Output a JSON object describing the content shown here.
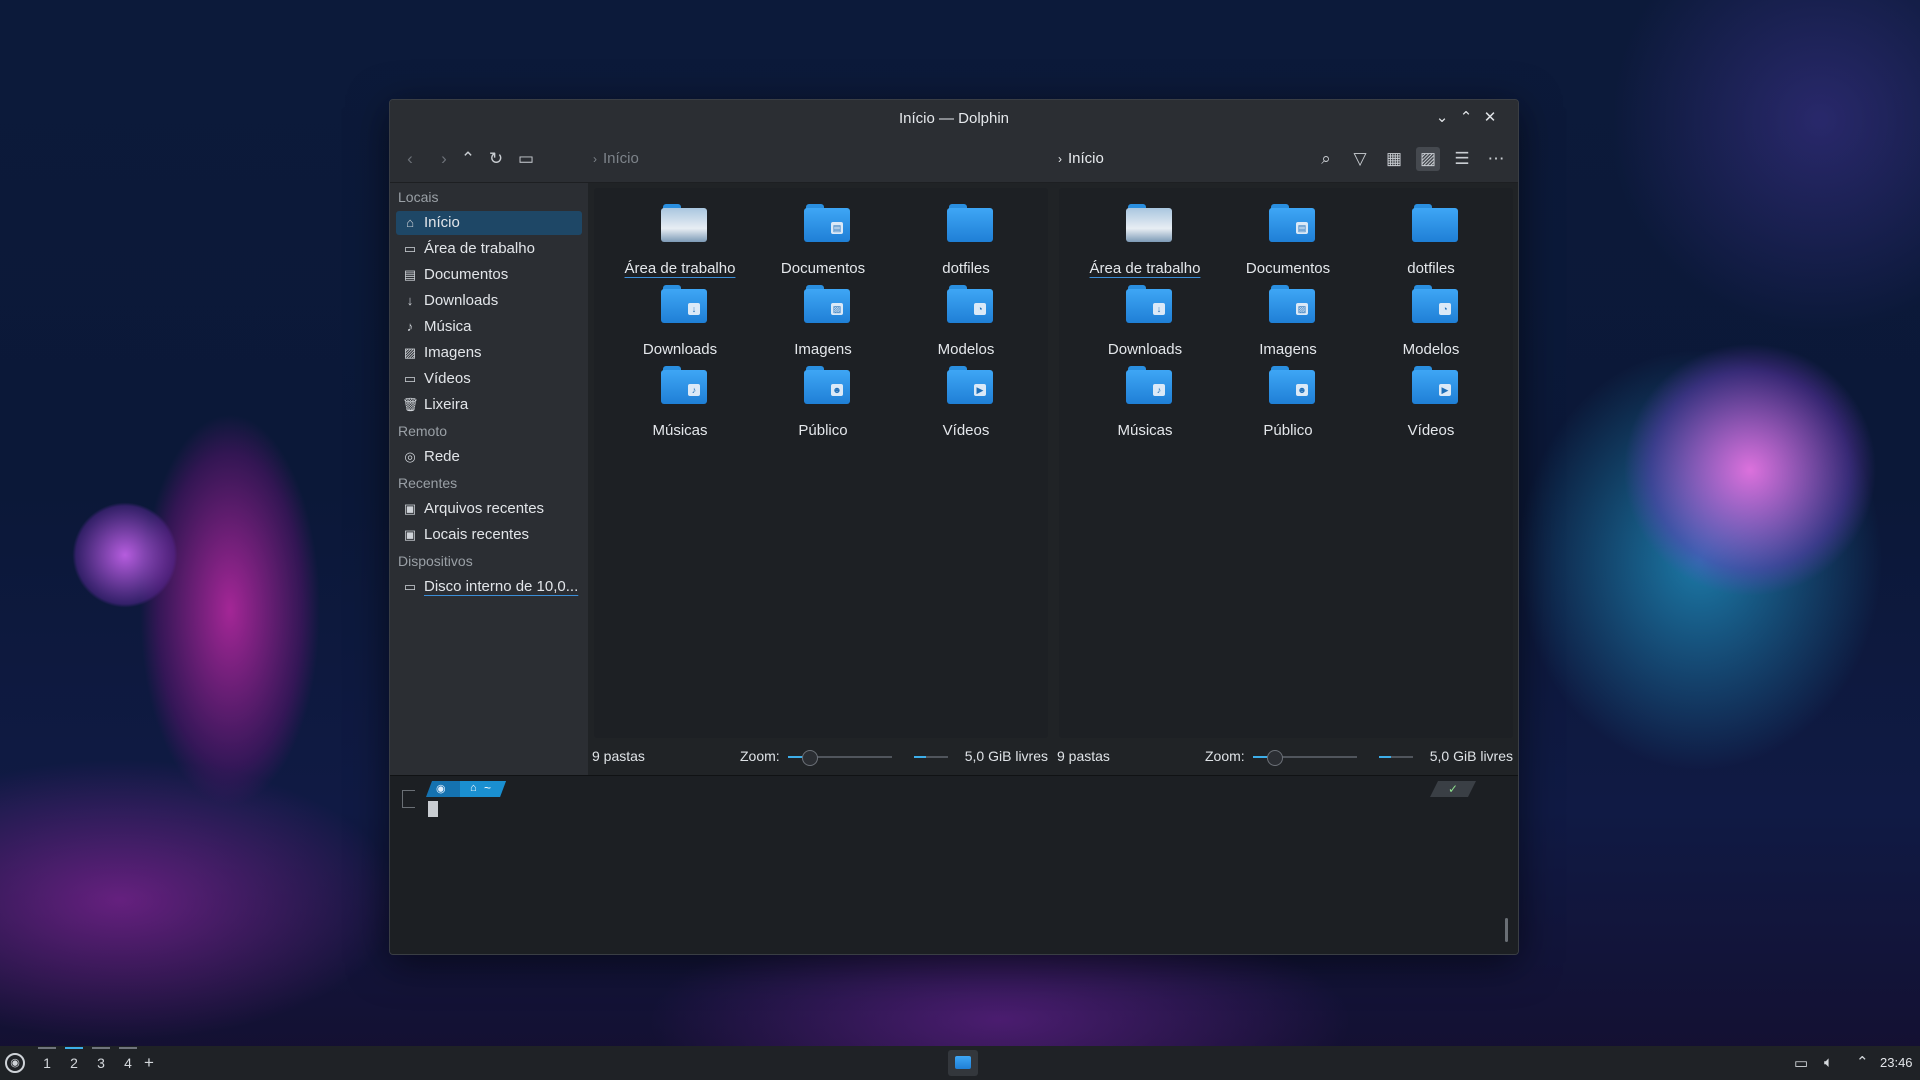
{
  "window": {
    "title": "Início — Dolphin",
    "controls": {
      "minimize": "⌄",
      "maximize": "⌃",
      "close": "✕"
    }
  },
  "toolbar": {
    "left_breadcrumb": "Início",
    "right_breadcrumb": "Início",
    "icons": [
      "back-icon",
      "forward-icon",
      "up-icon",
      "reload-icon",
      "new-tab-icon",
      "search-icon",
      "filter-icon",
      "icons-view-icon",
      "preview-icon",
      "split-view-icon",
      "menu-icon"
    ]
  },
  "sidebar": {
    "sections": [
      {
        "title": "Locais",
        "items": [
          {
            "label": "Início",
            "icon": "home-icon",
            "glyph": "⌂",
            "selected": true
          },
          {
            "label": "Área de trabalho",
            "icon": "desktop-icon",
            "glyph": "▭"
          },
          {
            "label": "Documentos",
            "icon": "documents-icon",
            "glyph": "▤"
          },
          {
            "label": "Downloads",
            "icon": "downloads-icon",
            "glyph": "↓"
          },
          {
            "label": "Música",
            "icon": "music-icon",
            "glyph": "♪"
          },
          {
            "label": "Imagens",
            "icon": "pictures-icon",
            "glyph": "▨"
          },
          {
            "label": "Vídeos",
            "icon": "videos-icon",
            "glyph": "▭"
          },
          {
            "label": "Lixeira",
            "icon": "trash-icon",
            "glyph": "🗑"
          }
        ]
      },
      {
        "title": "Remoto",
        "items": [
          {
            "label": "Rede",
            "icon": "network-icon",
            "glyph": "◎"
          }
        ]
      },
      {
        "title": "Recentes",
        "items": [
          {
            "label": "Arquivos recentes",
            "icon": "recent-files-icon",
            "glyph": "▣"
          },
          {
            "label": "Locais recentes",
            "icon": "recent-locations-icon",
            "glyph": "▣"
          }
        ]
      },
      {
        "title": "Dispositivos",
        "items": [
          {
            "label": "Disco interno de 10,0...",
            "icon": "drive-icon",
            "glyph": "▭"
          }
        ]
      }
    ]
  },
  "folders": [
    {
      "label": "Área de trabalho",
      "kind": "desktop",
      "emblem": ""
    },
    {
      "label": "Documentos",
      "kind": "folder",
      "emblem": "▤"
    },
    {
      "label": "dotfiles",
      "kind": "folder",
      "emblem": ""
    },
    {
      "label": "Downloads",
      "kind": "folder",
      "emblem": "↓"
    },
    {
      "label": "Imagens",
      "kind": "folder",
      "emblem": "▨"
    },
    {
      "label": "Modelos",
      "kind": "folder",
      "emblem": "◔"
    },
    {
      "label": "Músicas",
      "kind": "folder",
      "emblem": "♪"
    },
    {
      "label": "Público",
      "kind": "folder",
      "emblem": "☻"
    },
    {
      "label": "Vídeos",
      "kind": "folder",
      "emblem": "▶"
    }
  ],
  "statusbar": {
    "count": "9 pastas",
    "zoom_label": "Zoom:",
    "free_space": "5,0 GiB livres",
    "zoom_level": 0.2,
    "space_used": 0.35
  },
  "terminal": {
    "prompt_segment1": "~",
    "prompt_home_glyph": "⌂",
    "prompt_tilde": "~",
    "status_check": "✓"
  },
  "taskbar": {
    "desktops": [
      "1",
      "2",
      "3",
      "4"
    ],
    "add_desktop": "+",
    "clock": "23:46"
  },
  "colors": {
    "accent": "#3daee9",
    "folder": "#2b8fe6",
    "selection": "#1e4766"
  }
}
